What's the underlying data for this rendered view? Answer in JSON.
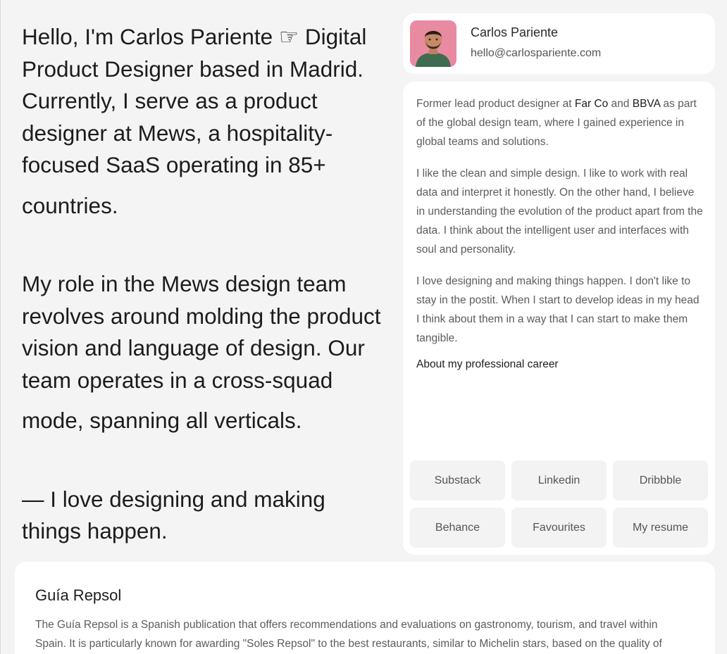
{
  "intro": {
    "paragraph1_line": "Hello, I'm Carlos Pariente ☞ Digital Product Designer based in Madrid. Currently, I serve as a product designer at Mews, a hospitality-focused SaaS operating in 85+",
    "paragraph1_tail": "countries.",
    "paragraph2_line": "My role in the Mews design team revolves around molding the product vision and language of design. Our team operates in a cross-squad",
    "paragraph2_tail": "mode, spanning all verticals.",
    "paragraph3": "— I love designing and making things happen."
  },
  "profile": {
    "name": "Carlos Pariente",
    "email": "hello@carlospariente.com"
  },
  "about": {
    "p1_prefix": "Former lead product designer at ",
    "p1_company1": "Far Co",
    "p1_and": " and ",
    "p1_company2": "BBVA",
    "p1_suffix": " as part of the global design team, where I gained experience in global teams and solutions.",
    "p2": "I like the clean and simple design. I like to work with real data and interpret it honestly. On the other hand, I believe in understanding the evolution of the product apart from the data. I think about the intelligent user and interfaces with soul and personality.",
    "p3": "I love designing and making things happen. I don't like to stay in the postit. When I start to develop ideas in my head I think about them in a way that I can start to make them tangible.",
    "career_link": "About my professional career"
  },
  "links": [
    "Substack",
    "Linkedin",
    "Dribbble",
    "Behance",
    "Favourites",
    "My resume"
  ],
  "project": {
    "title": "Guía Repsol",
    "description": "The Guía Repsol is a Spanish publication that offers recommendations and evaluations on gastronomy, tourism, and travel within Spain. It is particularly known for awarding \"Soles Repsol\" to the best restaurants, similar to Michelin stars, based on the quality of"
  },
  "colors": {
    "background": "#f4f4f4",
    "card": "#ffffff",
    "button": "#f3f3f3",
    "text_primary": "#1c1c1c",
    "text_secondary": "#5c5c5c"
  }
}
